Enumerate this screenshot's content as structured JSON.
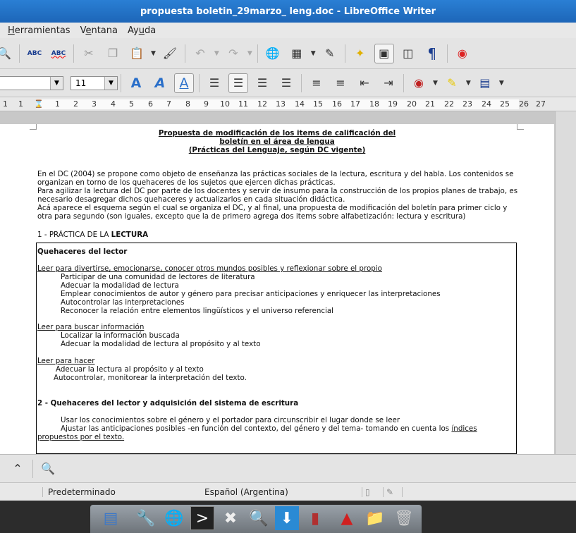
{
  "window": {
    "title": "propuesta boletin_29marzo_ leng.doc - LibreOffice Writer"
  },
  "menu": [
    {
      "label": "Herramientas",
      "underline_index": 0
    },
    {
      "label": "Ventana",
      "underline_index": 1
    },
    {
      "label": "Ayuda",
      "underline_index": 2
    }
  ],
  "toolbar": {
    "spellcheck_label": "ABC",
    "autospell_label": "ABC",
    "pilcrow": "¶"
  },
  "format": {
    "font_size": "11"
  },
  "ruler": {
    "ticks": [
      "1",
      "1",
      "2",
      "3",
      "4",
      "5",
      "6",
      "7",
      "8",
      "9",
      "10",
      "11",
      "12",
      "13",
      "14",
      "15",
      "16",
      "17",
      "18",
      "19",
      "20",
      "21",
      "22",
      "23",
      "24",
      "25",
      "26",
      "27"
    ]
  },
  "document": {
    "title_1": "Propuesta de modificación de los items de calificación del",
    "title_2": "boletín en el área de lengua",
    "title_3": "(Prácticas del Lenguaje, según DC vigente)",
    "intro_1": "En el DC (2004) se propone como objeto de enseñanza las prácticas sociales de la lectura, escritura y del habla. Los contenidos se",
    "intro_2": "organizan en torno de los quehaceres de los sujetos que ejercen dichas prácticas.",
    "intro_3": "Para agilizar la lectura del DC por parte de los docentes y servir de insumo para la construcción de los propios planes de trabajo, es",
    "intro_4": "necesario desagregar dichos quehaceres y actualizarlos en cada situación didáctica.",
    "intro_5": "Acá aparece el esquema según el cual se organiza el DC, y al final, una propuesta de modificación del boletín para primer ciclo y",
    "intro_6": "otra para segundo (son iguales, excepto que la de primero agrega dos items sobre alfabetización: lectura y escritura)",
    "sec1_prefix": "1 - PRÁCTICA DE LA ",
    "sec1_bold": "LECTURA",
    "sec1_sub": "Quehaceres del lector",
    "g1_head": "Leer para divertirse, emocionarse, conocer otros mundos posibles y reflexionar sobre el propio",
    "g1_items": [
      "Participar de una comunidad de lectores de literatura",
      "Adecuar la modalidad de lectura",
      "Emplear conocimientos de autor y género para precisar anticipaciones y enriquecer las interpretaciones",
      "Autocontrolar las interpretaciones",
      "Reconocer la relación entre elementos lingüísticos y el universo referencial"
    ],
    "g2_head": "Leer para buscar información",
    "g2_items": [
      "Localizar la información buscada",
      "Adecuar la modalidad de lectura al propósito y al texto"
    ],
    "g3_head": "Leer para hacer",
    "g3_item_1": "Adecuar la lectura al propósito y al texto",
    "g3_item_2": "Autocontrolar, monitorear la interpretación del texto.",
    "sec2": "2 - Quehaceres del lector y adquisición del sistema de escritura",
    "sec2_item_1": "Usar los conocimientos sobre el género y el portador para circunscribir el lugar donde se leer",
    "sec2_item_2a": "Ajustar las anticipaciones posibles -en función del contexto, del género y del tema- tomando en cuenta los ",
    "sec2_item_2b": "índices",
    "sec2_item_2c": "propuestos por el texto."
  },
  "status": {
    "page_style": "Predeterminado",
    "language": "Español (Argentina)"
  }
}
